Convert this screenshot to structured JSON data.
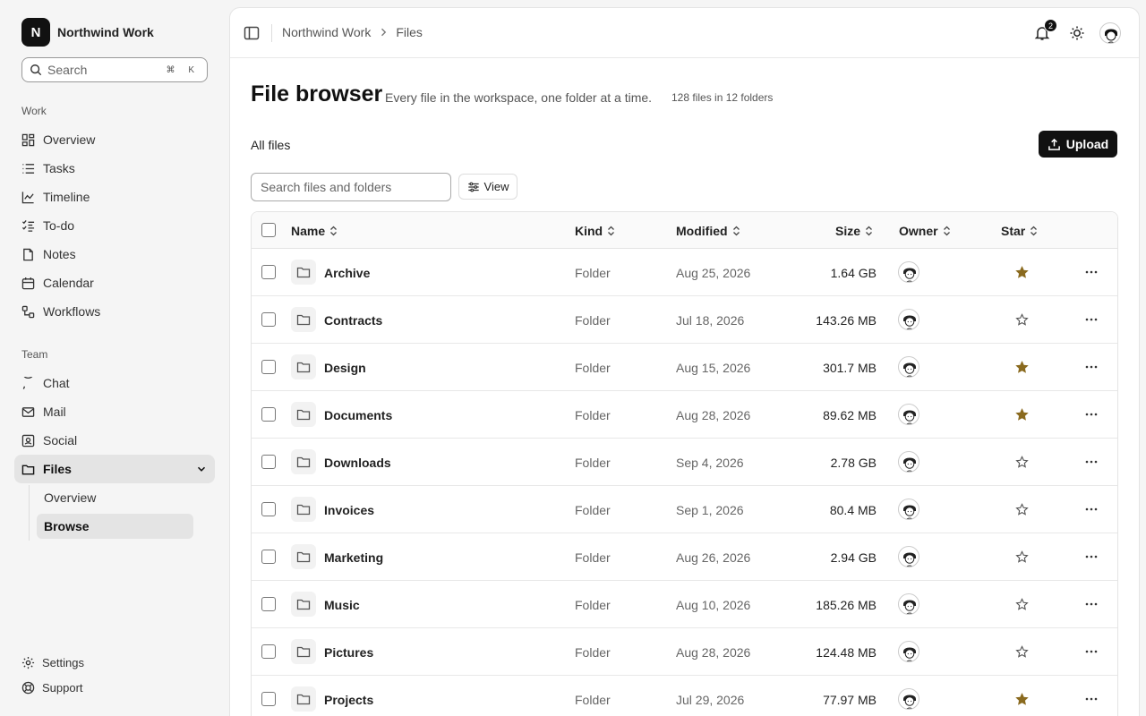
{
  "brand": {
    "initial": "N",
    "name": "Northwind Work"
  },
  "search": {
    "label": "Search",
    "shortcut": "⌘ K"
  },
  "sections": {
    "work": "Work",
    "team": "Team"
  },
  "nav": {
    "work": [
      {
        "label": "Overview",
        "icon": "grid-icon"
      },
      {
        "label": "Tasks",
        "icon": "list-icon"
      },
      {
        "label": "Timeline",
        "icon": "chart-line-icon"
      },
      {
        "label": "To-do",
        "icon": "checklist-icon"
      },
      {
        "label": "Notes",
        "icon": "note-icon"
      },
      {
        "label": "Calendar",
        "icon": "calendar-icon"
      },
      {
        "label": "Workflows",
        "icon": "workflow-icon"
      }
    ],
    "team": [
      {
        "label": "Chat",
        "icon": "chat-icon"
      },
      {
        "label": "Mail",
        "icon": "mail-icon"
      },
      {
        "label": "Social",
        "icon": "social-icon"
      }
    ],
    "files": {
      "label": "Files",
      "icon": "folder-icon",
      "expanded": true,
      "children": [
        {
          "label": "Overview",
          "active": false
        },
        {
          "label": "Browse",
          "active": true
        }
      ]
    },
    "footer": [
      {
        "label": "Settings",
        "icon": "gear-icon"
      },
      {
        "label": "Support",
        "icon": "lifebuoy-icon"
      }
    ]
  },
  "topbar": {
    "breadcrumb": [
      "Northwind Work",
      "Files"
    ],
    "notifications_count": "2"
  },
  "page": {
    "title": "File browser",
    "description": "Every file in the workspace, one folder at a time.",
    "count": "128 files in 12 folders",
    "section": "All files",
    "upload_label": "Upload",
    "filter_placeholder": "Search files and folders",
    "view_label": "View"
  },
  "table": {
    "columns": [
      "Name",
      "Kind",
      "Modified",
      "Size",
      "Owner",
      "Star"
    ],
    "rows": [
      {
        "name": "Archive",
        "kind": "Folder",
        "modified": "Aug 25, 2026",
        "size": "1.64 GB",
        "starred": true
      },
      {
        "name": "Contracts",
        "kind": "Folder",
        "modified": "Jul 18, 2026",
        "size": "143.26 MB",
        "starred": false
      },
      {
        "name": "Design",
        "kind": "Folder",
        "modified": "Aug 15, 2026",
        "size": "301.7 MB",
        "starred": true
      },
      {
        "name": "Documents",
        "kind": "Folder",
        "modified": "Aug 28, 2026",
        "size": "89.62 MB",
        "starred": true
      },
      {
        "name": "Downloads",
        "kind": "Folder",
        "modified": "Sep 4, 2026",
        "size": "2.78 GB",
        "starred": false
      },
      {
        "name": "Invoices",
        "kind": "Folder",
        "modified": "Sep 1, 2026",
        "size": "80.4 MB",
        "starred": false
      },
      {
        "name": "Marketing",
        "kind": "Folder",
        "modified": "Aug 26, 2026",
        "size": "2.94 GB",
        "starred": false
      },
      {
        "name": "Music",
        "kind": "Folder",
        "modified": "Aug 10, 2026",
        "size": "185.26 MB",
        "starred": false
      },
      {
        "name": "Pictures",
        "kind": "Folder",
        "modified": "Aug 28, 2026",
        "size": "124.48 MB",
        "starred": false
      },
      {
        "name": "Projects",
        "kind": "Folder",
        "modified": "Jul 29, 2026",
        "size": "77.97 MB",
        "starred": true
      }
    ]
  },
  "colors": {
    "star_filled": "#8a6a1f",
    "accent": "#111111"
  }
}
